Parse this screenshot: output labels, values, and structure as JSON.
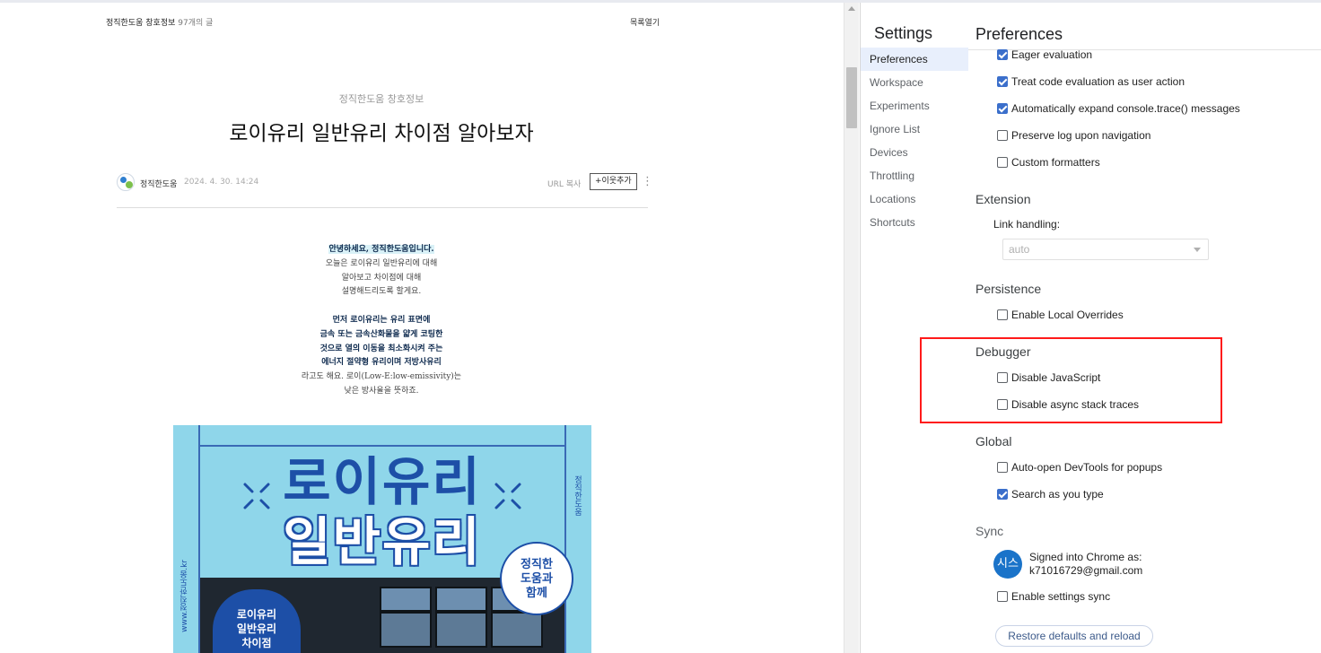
{
  "blog": {
    "header_left_title": "정직한도움 창호정보",
    "header_left_count": "97개의 글",
    "header_right": "목록열기",
    "category": "정직한도움 창호정보",
    "title": "로이유리 일반유리 차이점 알아보자",
    "author": "정직한도움",
    "date": "2024. 4. 30. 14:24",
    "url_copy": "URL 복사",
    "neighbor_add": "+이웃추가",
    "more": "⋮",
    "paragraphs": {
      "p1": [
        "안녕하세요, 정직한도움입니다.",
        "오늘은 로이유리 일반유리에 대해",
        "알아보고 차이점에 대해",
        "설명해드리도록 할게요."
      ],
      "p2": [
        "먼저 로이유리는 유리 표면에",
        "금속 또는 금속산화물을 얇게 코팅한",
        "것으로 열의 이동을 최소화시켜 주는",
        "에너지 절약형 유리이며 저방사유리",
        "라고도 해요. 로이(Low-E:low-emissivity)는",
        "낮은 방사율을 뜻하죠."
      ]
    },
    "poster": {
      "line1": "로이유리",
      "line2": "일반유리",
      "side_text": "정직한도움",
      "url_vertical": "www.정직한도움.kr",
      "bubble": [
        "정직한",
        "도움과",
        "함께"
      ],
      "flower": [
        "로이유리",
        "일반유리",
        "차이점"
      ]
    }
  },
  "settings": {
    "title": "Settings",
    "nav": [
      "Preferences",
      "Workspace",
      "Experiments",
      "Ignore List",
      "Devices",
      "Throttling",
      "Locations",
      "Shortcuts"
    ],
    "active_nav": "Preferences",
    "panel_title": "Preferences",
    "console_options": [
      {
        "label": "Eager evaluation",
        "checked": true
      },
      {
        "label": "Treat code evaluation as user action",
        "checked": true
      },
      {
        "label": "Automatically expand console.trace() messages",
        "checked": true
      },
      {
        "label": "Preserve log upon navigation",
        "checked": false
      },
      {
        "label": "Custom formatters",
        "checked": false
      }
    ],
    "extension": {
      "title": "Extension",
      "link_handling_label": "Link handling:",
      "link_handling_value": "auto"
    },
    "persistence": {
      "title": "Persistence",
      "options": [
        {
          "label": "Enable Local Overrides",
          "checked": false
        }
      ]
    },
    "debugger": {
      "title": "Debugger",
      "options": [
        {
          "label": "Disable JavaScript",
          "checked": false
        },
        {
          "label": "Disable async stack traces",
          "checked": false
        }
      ]
    },
    "global": {
      "title": "Global",
      "options": [
        {
          "label": "Auto-open DevTools for popups",
          "checked": false
        },
        {
          "label": "Search as you type",
          "checked": true
        }
      ]
    },
    "sync": {
      "title": "Sync",
      "avatar_text": "시스",
      "signed_in_line1": "Signed into Chrome as:",
      "signed_in_line2": "k71016729@gmail.com",
      "options": [
        {
          "label": "Enable settings sync",
          "checked": false
        }
      ]
    },
    "restore_button": "Restore defaults and reload"
  },
  "colors": {
    "accent": "#3b6fcb",
    "highlight_border": "#ff1a1a",
    "poster_bg": "#8fd6ea",
    "poster_blue": "#1d4fa7"
  }
}
